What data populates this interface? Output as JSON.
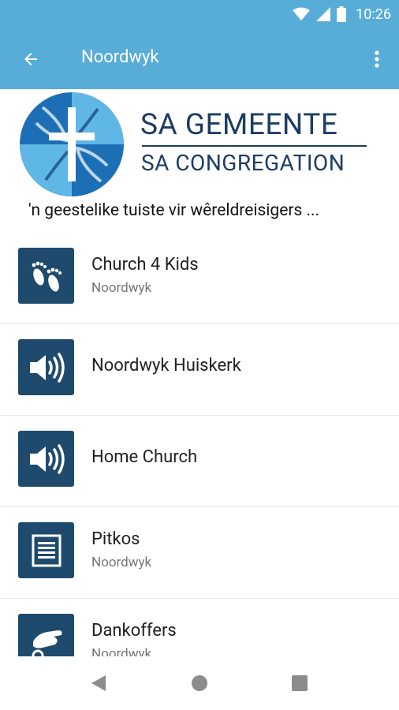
{
  "colors": {
    "app_bar": "#57add8",
    "icon_tile": "#1e4a6d",
    "brand_text": "#1d3d63"
  },
  "status_bar": {
    "time": "10:26",
    "icons": [
      "wifi-icon",
      "signal-icon",
      "battery-icon"
    ]
  },
  "app_bar": {
    "title": "Noordwyk",
    "back_icon": "arrow-left-icon",
    "menu_icon": "more-vert-icon"
  },
  "banner": {
    "name": "SA GEMEENTE",
    "subtitle": "SA CONGREGATION",
    "tagline": "'n geestelike tuiste vir wêreldreisigers ..."
  },
  "list": {
    "items": [
      {
        "title": "Church 4 Kids",
        "subtitle": "Noordwyk",
        "icon": "footprints-icon"
      },
      {
        "title": "Noordwyk Huiskerk",
        "icon": "speaker-icon"
      },
      {
        "title": "Home Church",
        "icon": "speaker-icon"
      },
      {
        "title": "Pitkos",
        "subtitle": "Noordwyk",
        "icon": "document-icon"
      },
      {
        "title": "Dankoffers",
        "subtitle": "Noordwyk",
        "icon": "offering-hand-icon"
      }
    ]
  },
  "nav_bar": {
    "icons": [
      "back-triangle-icon",
      "home-circle-icon",
      "recents-square-icon"
    ]
  }
}
